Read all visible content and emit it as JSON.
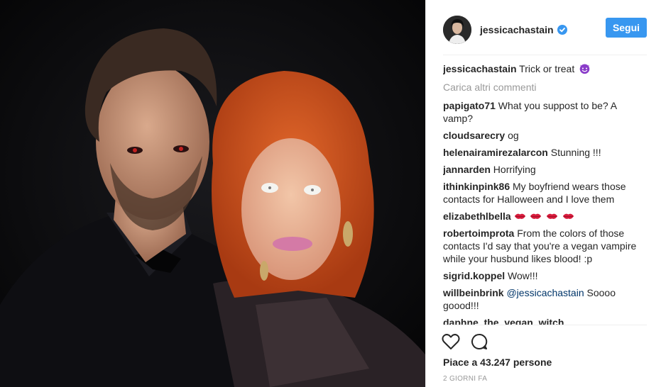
{
  "post": {
    "author": "jessicachastain",
    "follow_label": "Segui",
    "caption_user": "jessicachastain",
    "caption_text": "Trick or treat",
    "load_more_label": "Carica altri commenti",
    "comments": [
      {
        "user": "papigato71",
        "text": "What you suppost to be? A vamp?"
      },
      {
        "user": "cloudsarecry",
        "text": "og"
      },
      {
        "user": "helenairamirezalarcon",
        "text": "Stunning !!!"
      },
      {
        "user": "jannarden",
        "text": "Horrifying"
      },
      {
        "user": "ithinkinpink86",
        "text": "My boyfriend wears those contacts for Halloween and I love them"
      },
      {
        "user": "elizabethlbella",
        "text": ""
      },
      {
        "user": "robertoimprota",
        "text": "From the colors of those contacts I'd say that you're a vegan vampire while your husbund likes blood! :p"
      },
      {
        "user": "sigrid.koppel",
        "text": "Wow!!!"
      },
      {
        "user": "willbeinbrink",
        "mention": "@jessicachastain",
        "text": "Soooo goood!!!"
      },
      {
        "user": "daphne_the_vegan_witch",
        "text": ""
      }
    ],
    "likes_text": "Piace a 43.247 persone",
    "time_ago": "2 GIORNI FA"
  },
  "icons": {
    "verified": "verified-badge-icon",
    "like": "heart-icon",
    "comment": "speech-bubble-icon"
  },
  "colors": {
    "accent": "#3897f0",
    "mention": "#003569",
    "muted": "#999999"
  }
}
